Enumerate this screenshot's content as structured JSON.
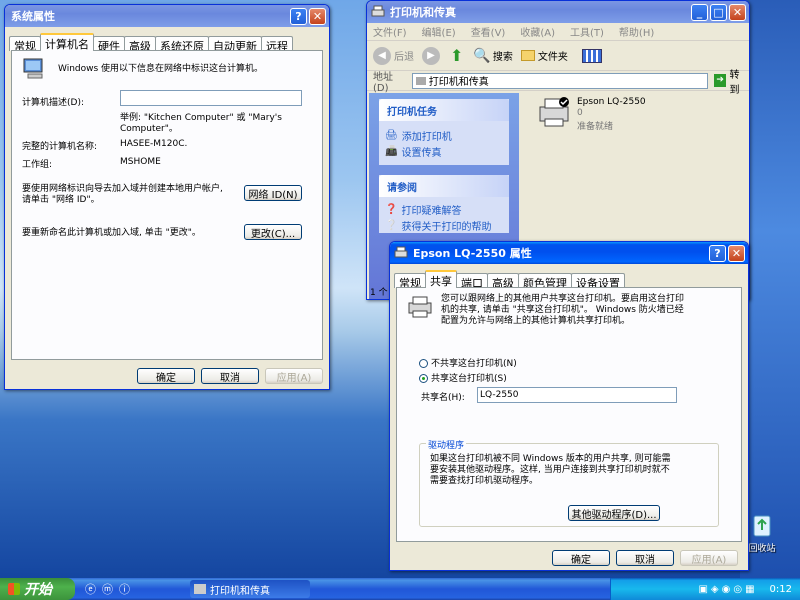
{
  "sysprops": {
    "title": "系统属性",
    "tabs": [
      "常规",
      "计算机名",
      "硬件",
      "高级",
      "系统还原",
      "自动更新",
      "远程"
    ],
    "intro": "Windows 使用以下信息在网络中标识这台计算机。",
    "desc_label": "计算机描述(D):",
    "example": "举例: \"Kitchen Computer\" 或 \"Mary's Computer\"。",
    "fullname_label": "完整的计算机名称:",
    "fullname_value": "HASEE-M120C.",
    "workgroup_label": "工作组:",
    "workgroup_value": "MSHOME",
    "networkid_text": "要使用网络标识向导去加入域并创建本地用户帐户, 请单击 \"网络 ID\"。",
    "networkid_btn": "网络 ID(N)",
    "rename_text": "要重新命名此计算机或加入域, 单击 \"更改\"。",
    "change_btn": "更改(C)...",
    "ok": "确定",
    "cancel": "取消",
    "apply": "应用(A)"
  },
  "explorer": {
    "title": "打印机和传真",
    "menu": [
      "文件(F)",
      "编辑(E)",
      "查看(V)",
      "收藏(A)",
      "工具(T)",
      "帮助(H)"
    ],
    "back": "后退",
    "search": "搜索",
    "folders": "文件夹",
    "address_label": "地址(D)",
    "address_value": "打印机和传真",
    "go": "转到",
    "tasks_header": "打印机任务",
    "task_add": "添加打印机",
    "task_fax": "设置传真",
    "see_header": "请参阅",
    "see_trouble": "打印疑难解答",
    "see_help": "获得关于打印的帮助",
    "printer_name": "Epson LQ-2550",
    "printer_count": "0",
    "printer_status": "准备就绪",
    "statusbar": "1 个"
  },
  "printerprops": {
    "title": "Epson LQ-2550 属性",
    "tabs": [
      "常规",
      "共享",
      "端口",
      "高级",
      "颜色管理",
      "设备设置"
    ],
    "share_info": "您可以跟网络上的其他用户共享这台打印机。要启用这台打印机的共享, 请单击 \"共享这台打印机\"。 Windows 防火墙已经配置为允许与网络上的其他计算机共享打印机。",
    "no_share": "不共享这台打印机(N)",
    "share": "共享这台打印机(S)",
    "share_name_label": "共享名(H):",
    "share_name_value": "LQ-2550",
    "drivers_group": "驱动程序",
    "drivers_text": "如果这台打印机被不同 Windows 版本的用户共享, 则可能需要安装其他驱动程序。这样, 当用户连接到共享打印机时就不需要查找打印机驱动程序。",
    "other_drivers_btn": "其他驱动程序(D)...",
    "ok": "确定",
    "cancel": "取消",
    "apply": "应用(A)"
  },
  "desktop": {
    "recycle": "回收站"
  },
  "taskbar": {
    "start": "开始",
    "task": "打印机和传真",
    "clock": "0:12"
  }
}
